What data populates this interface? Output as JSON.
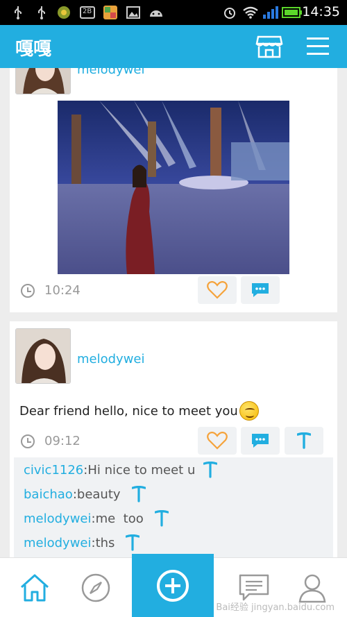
{
  "status_bar": {
    "time": "14:35",
    "icons": [
      "usb-icon",
      "usb-icon",
      "app-icon",
      "sim-icon",
      "gallery-app-icon",
      "image-icon",
      "android-icon",
      "alarm-icon",
      "wifi-icon",
      "signal-icon",
      "battery-icon"
    ],
    "sim_label": "2B"
  },
  "header": {
    "title": "嘎嘎",
    "store_icon": "store-icon",
    "menu_icon": "menu-icon"
  },
  "posts": [
    {
      "username": "melodywei",
      "time": "10:24",
      "actions": [
        "like-icon",
        "comment-icon"
      ]
    },
    {
      "username": "melodywei",
      "text": "Dear friend hello, nice to meet you",
      "time": "09:12",
      "actions": [
        "like-icon",
        "comment-icon",
        "t-icon"
      ],
      "comments": [
        {
          "user": "civic1126",
          "text": "Hi nice to meet u"
        },
        {
          "user": "baichao",
          "text": "beauty"
        },
        {
          "user": "melodywei",
          "text": "me  too"
        },
        {
          "user": "melodywei",
          "text": "ths"
        }
      ]
    }
  ],
  "bottom_nav": {
    "items": [
      "home-icon",
      "compass-icon",
      "add-icon",
      "message-icon",
      "profile-icon"
    ],
    "watermark": "Bai经验 jingyan.baidu.com"
  },
  "colors": {
    "accent": "#22aee0",
    "like": "#f5a33c",
    "background": "#ededed"
  }
}
